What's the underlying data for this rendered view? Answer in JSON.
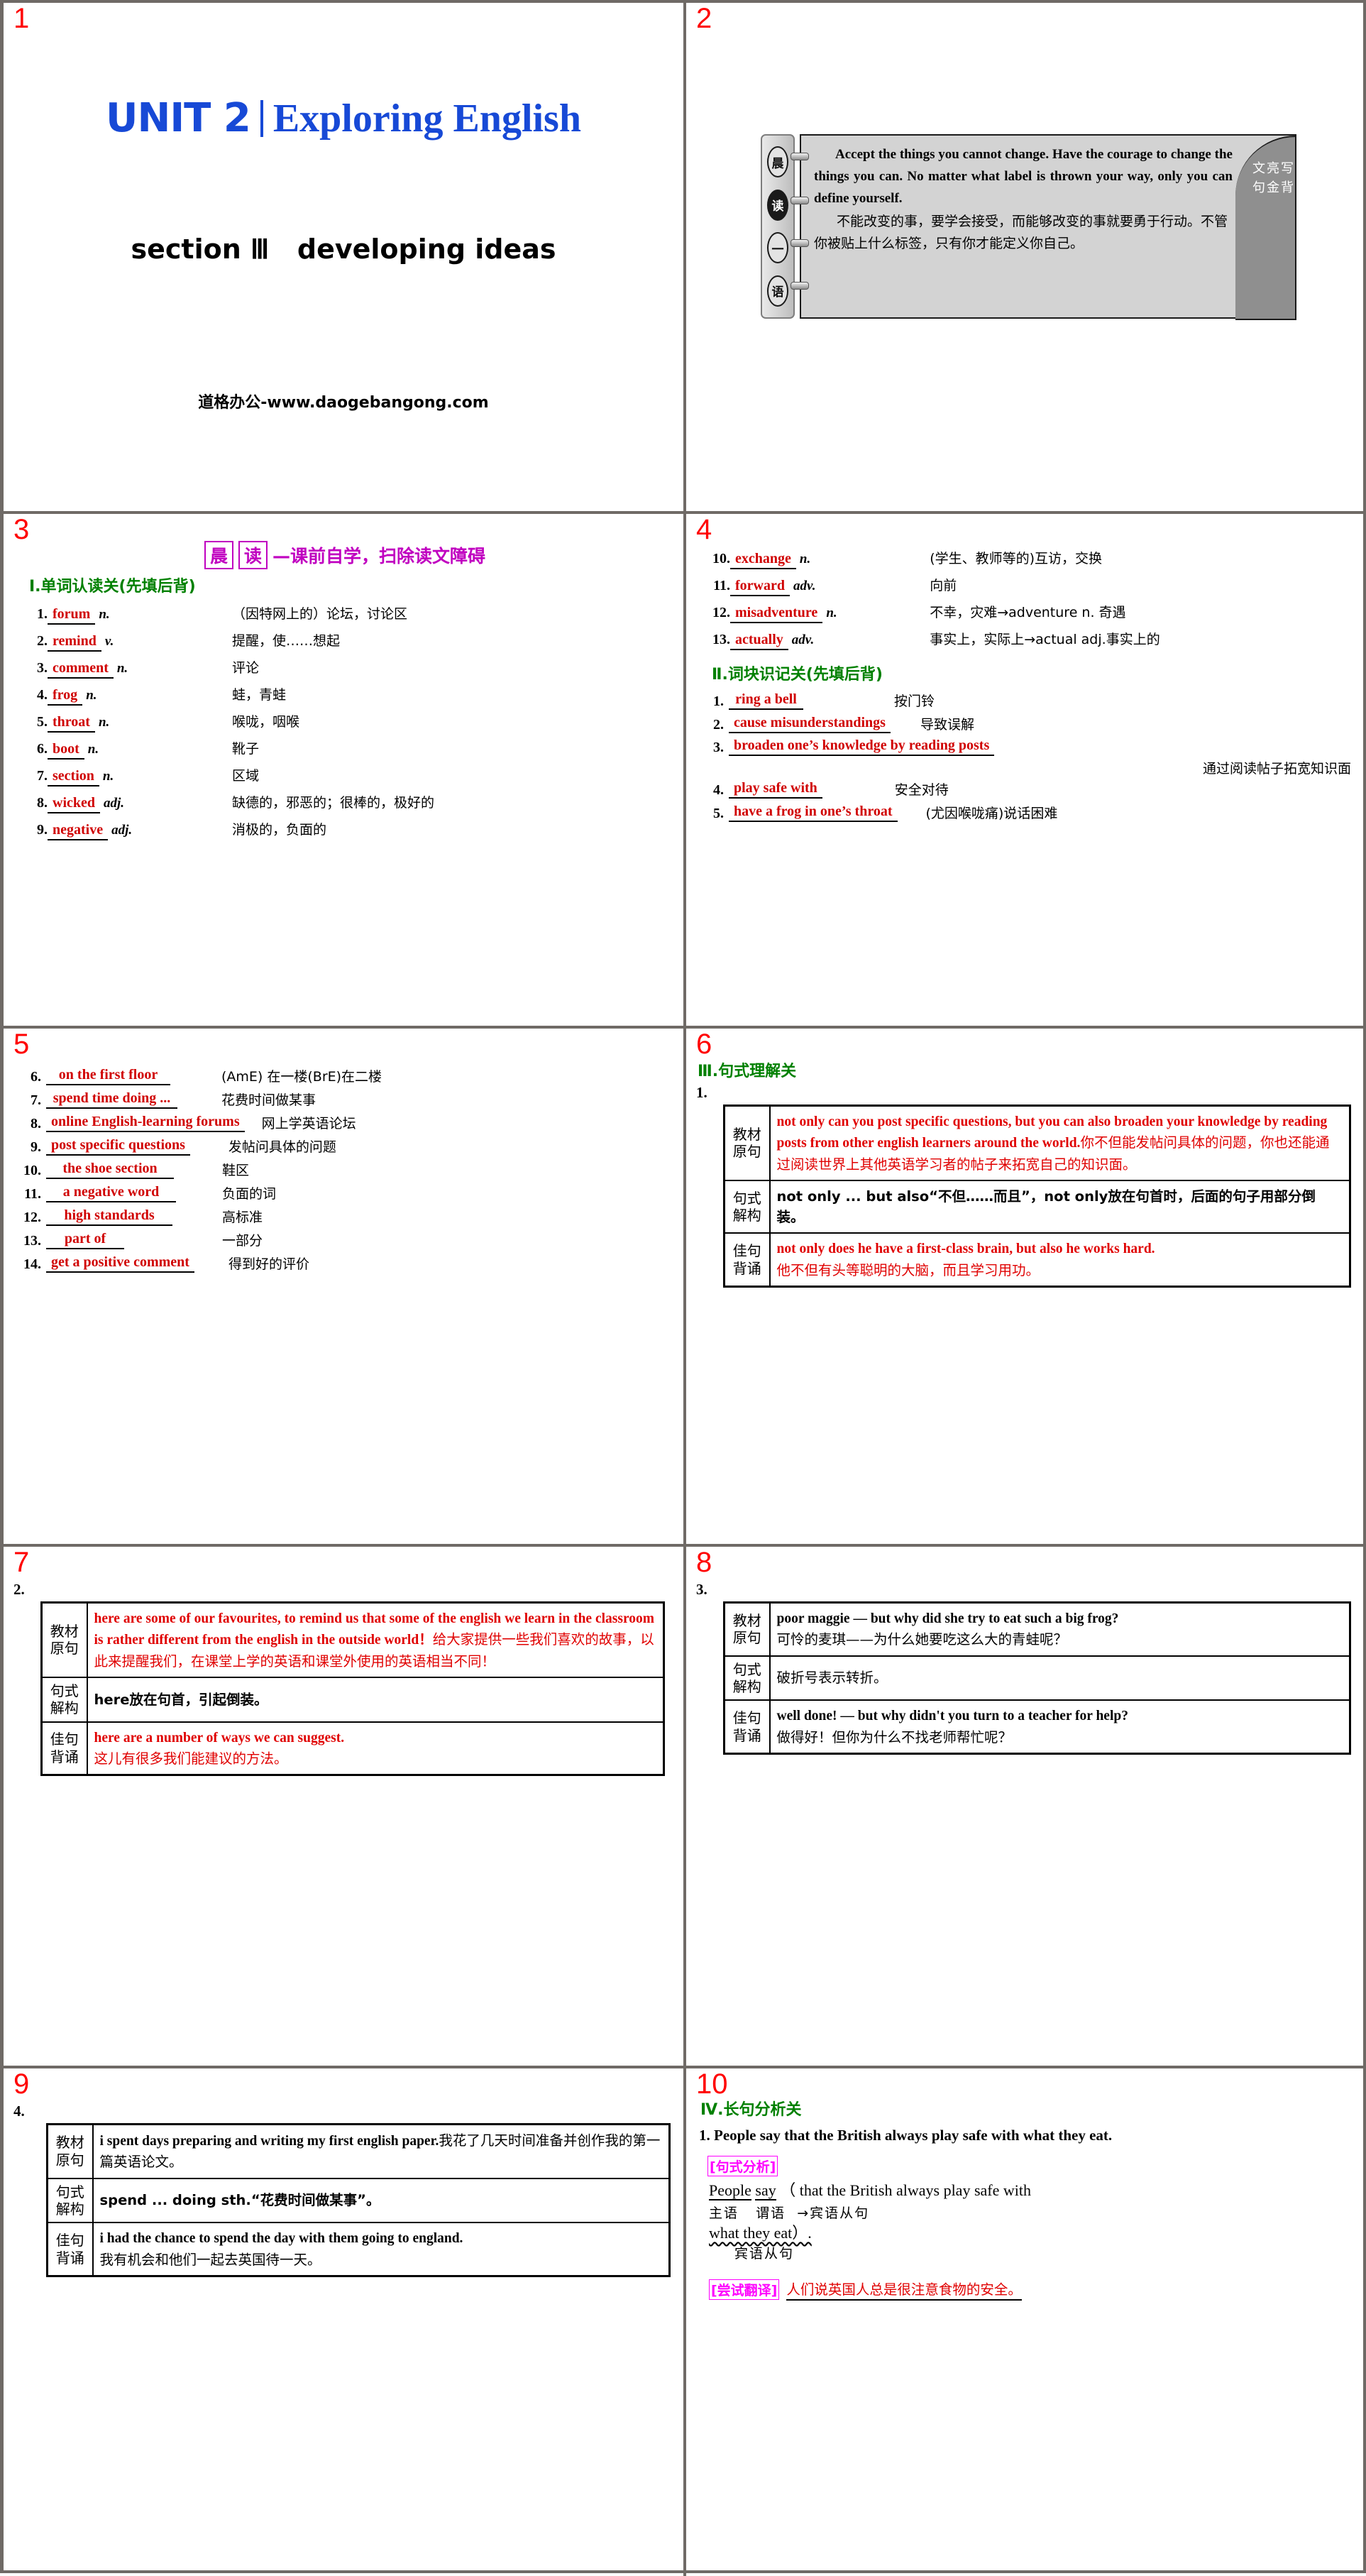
{
  "slides": [
    {
      "number": "1"
    },
    {
      "number": "2"
    },
    {
      "number": "3"
    },
    {
      "number": "4"
    },
    {
      "number": "5"
    },
    {
      "number": "6"
    },
    {
      "number": "7"
    },
    {
      "number": "8"
    },
    {
      "number": "9"
    },
    {
      "number": "10"
    }
  ],
  "slide1": {
    "unit": "UNIT 2",
    "unit_title": "Exploring English",
    "section": "section",
    "section_numeral": "Ⅲ",
    "section_name": "developing ideas",
    "watermark": "道格办公-www.daogebangong.com"
  },
  "slide2": {
    "left_tab": [
      "晨",
      "读",
      "一",
      "语"
    ],
    "corner_tab_col1": "写背",
    "corner_tab_col2": "亮金",
    "corner_tab_col3": "文句",
    "quote_en": "Accept the things you cannot change. Have the courage to change the things you can. No matter what label is thrown your way, only you can define yourself.",
    "quote_cn": "不能改变的事，要学会接受，而能够改变的事就要勇于行动。不管你被贴上什么标签，只有你才能定义你自己。"
  },
  "slide3": {
    "header_char1": "晨",
    "header_char2": "读",
    "header_rest": "—课前自学，扫除读文障碍",
    "section_title": "Ⅰ.单词认读关(先填后背)",
    "words": [
      {
        "n": "1.",
        "word": "forum",
        "pos": "n.",
        "cn": "（因特网上的）论坛，讨论区"
      },
      {
        "n": "2.",
        "word": "remind",
        "pos": "v.",
        "cn": "提醒，使……想起"
      },
      {
        "n": "3.",
        "word": "comment",
        "pos": "n.",
        "cn": "评论"
      },
      {
        "n": "4.",
        "word": "frog",
        "pos": "n.",
        "cn": "蛙，青蛙"
      },
      {
        "n": "5.",
        "word": "throat",
        "pos": "n.",
        "cn": "喉咙，咽喉"
      },
      {
        "n": "6.",
        "word": "boot",
        "pos": "n.",
        "cn": "靴子"
      },
      {
        "n": "7.",
        "word": "section",
        "pos": "n.",
        "cn": "区域"
      },
      {
        "n": "8.",
        "word": "wicked",
        "pos": "adj.",
        "cn": "缺德的，邪恶的；很棒的，极好的"
      },
      {
        "n": "9.",
        "word": "negative",
        "pos": "adj.",
        "cn": "消极的，负面的"
      }
    ]
  },
  "slide4": {
    "words": [
      {
        "n": "10.",
        "word": "exchange",
        "pos": "n.",
        "cn": "(学生、教师等的)互访，交换"
      },
      {
        "n": "11.",
        "word": "forward",
        "pos": "adv.",
        "cn": "向前"
      },
      {
        "n": "12.",
        "word": "misadventure",
        "pos": "n.",
        "cn": "不幸，灾难→adventure n. 奇遇"
      },
      {
        "n": "13.",
        "word": "actually",
        "pos": "adv.",
        "cn": "事实上，实际上→actual adj.事实上的"
      }
    ],
    "section_title": "Ⅱ.词块识记关(先填后背)",
    "chunks": [
      {
        "n": "1.",
        "en": "ring a bell",
        "cn": "按门铃"
      },
      {
        "n": "2.",
        "en": "cause misunderstandings",
        "cn": "导致误解"
      },
      {
        "n": "3.",
        "en": "broaden one’s knowledge by reading posts",
        "cn": "通过阅读帖子拓宽知识面"
      },
      {
        "n": "4.",
        "en": "play safe with",
        "cn": "安全对待"
      },
      {
        "n": "5.",
        "en": "have a frog in one’s throat",
        "cn": "(尤因喉咙痛)说话困难"
      }
    ]
  },
  "slide5": {
    "chunks": [
      {
        "n": "6.",
        "en": "on the first floor",
        "cn": "(AmE) 在一楼(BrE)在二楼"
      },
      {
        "n": "7.",
        "en": "spend time doing ...",
        "cn": "花费时间做某事"
      },
      {
        "n": "8.",
        "en": "online English-learning forums",
        "cn": "网上学英语论坛"
      },
      {
        "n": "9.",
        "en": "post specific questions",
        "cn": "发帖问具体的问题"
      },
      {
        "n": "10.",
        "en": "the shoe section",
        "cn": "鞋区"
      },
      {
        "n": "11.",
        "en": "a negative word",
        "cn": "负面的词"
      },
      {
        "n": "12.",
        "en": "high standards",
        "cn": "高标准"
      },
      {
        "n": "13.",
        "en": "part of",
        "cn": "一部分"
      },
      {
        "n": "14.",
        "en": "get a positive comment",
        "cn": "得到好的评价"
      }
    ]
  },
  "slide6": {
    "section_title": "Ⅲ.句式理解关",
    "item_number": "1.",
    "label_text": "教材\n原句",
    "label_struct": "句式\n解构",
    "label_recite": "佳句\n背诵",
    "text_en": "not only can you post specific questions, but you can also broaden your knowledge by reading posts from other english learners around the world.",
    "text_cn": "你不但能发帖问具体的问题，你也还能通过阅读世界上其他英语学习者的帖子来拓宽自己的知识面。",
    "struct_text": "not only ... but also“不但……而且”，not only放在句首时，后面的句子用部分倒装。",
    "recite_en": "not only does he have a first-class brain, but also he works hard.",
    "recite_cn": "他不但有头等聪明的大脑，而且学习用功。"
  },
  "slide7": {
    "item_number": "2.",
    "label_text": "教材\n原句",
    "label_struct": "句式\n解构",
    "label_recite": "佳句\n背诵",
    "text_en": "here are some of our favourites, to remind us that some of the english we learn in the classroom is rather different from the english in the outside world！",
    "text_cn": "给大家提供一些我们喜欢的故事，以此来提醒我们，在课堂上学的英语和课堂外使用的英语相当不同！",
    "struct_text": "here放在句首，引起倒装。",
    "recite_en": "here are a number of ways we can suggest.",
    "recite_cn": "这儿有很多我们能建议的方法。"
  },
  "slide8": {
    "item_number": "3.",
    "label_text": "教材\n原句",
    "label_struct": "句式\n解构",
    "label_recite": "佳句\n背诵",
    "text_en": "poor maggie — but why did she try to eat such a big frog?",
    "text_cn": "可怜的麦琪——为什么她要吃这么大的青蛙呢？",
    "struct_text": "破折号表示转折。",
    "recite_en": "well done! — but why didn't you turn to a teacher for help?",
    "recite_cn": "做得好！但你为什么不找老师帮忙呢？"
  },
  "slide9": {
    "item_number": "4.",
    "label_text": "教材\n原句",
    "label_struct": "句式\n解构",
    "label_recite": "佳句\n背诵",
    "text_en": "i spent days preparing and writing my first english paper.",
    "text_cn": "我花了几天时间准备并创作我的第一篇英语论文。",
    "struct_text": "spend ... doing sth.“花费时间做某事”。",
    "recite_en": "i had the chance to spend the day with them going to england.",
    "recite_cn": "我有机会和他们一起去英国待一天。"
  },
  "slide10": {
    "section_title": "Ⅳ.长句分析关",
    "item_number": "1.",
    "sentence": "People say that the British always play safe with what they eat.",
    "tag_analysis": "[句式分析]",
    "part_subject": "People",
    "part_verb": "say",
    "part_rest": "（ that the British always play safe with",
    "part_rest2": "what they eat）.",
    "label_subject": "主语",
    "label_predicate": "谓语",
    "label_object_arrow": "→宾语从句",
    "label_object": "宾语从句",
    "tag_translate": "[尝试翻译]",
    "translation": "人们说英国人总是很注意食物的安全。"
  },
  "colors": {
    "accent_blue": "#1749d6",
    "red": "#e00000",
    "slide_number_red": "#ff0000",
    "green": "#008000",
    "magenta": "#c000c0",
    "pink": "#ff00ff",
    "grid_gray": "#6f6a66"
  }
}
